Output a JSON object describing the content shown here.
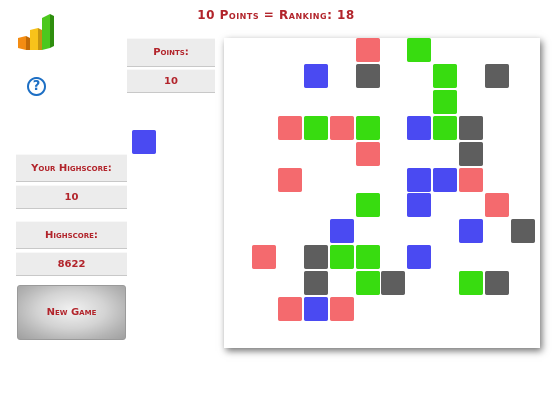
{
  "status_text": "10 Points = Ranking: 18",
  "points": {
    "label": "Points:",
    "value": "10"
  },
  "your_highscore": {
    "label": "Your Highscore:",
    "value": "10"
  },
  "highscore": {
    "label": "Highscore:",
    "value": "8622"
  },
  "new_game_label": "New Game",
  "help_symbol": "?",
  "icons": {
    "logo": "bar-chart-logo-icon",
    "help": "question-mark-icon"
  },
  "colors": {
    "red": "#f46a6e",
    "green": "#38dc10",
    "blue": "#4a4af2",
    "gray": "#5e5e5e",
    "accent_text": "#b2242b",
    "help_blue": "#1d6fc4"
  },
  "next_tile": "blue",
  "tiles": [
    {
      "row": 0,
      "col": 5,
      "color": "red"
    },
    {
      "row": 0,
      "col": 7,
      "color": "green"
    },
    {
      "row": 1,
      "col": 3,
      "color": "blue"
    },
    {
      "row": 1,
      "col": 5,
      "color": "gray"
    },
    {
      "row": 1,
      "col": 8,
      "color": "green"
    },
    {
      "row": 1,
      "col": 10,
      "color": "gray"
    },
    {
      "row": 2,
      "col": 8,
      "color": "green"
    },
    {
      "row": 3,
      "col": 2,
      "color": "red"
    },
    {
      "row": 3,
      "col": 3,
      "color": "green"
    },
    {
      "row": 3,
      "col": 4,
      "color": "red"
    },
    {
      "row": 3,
      "col": 5,
      "color": "green"
    },
    {
      "row": 3,
      "col": 7,
      "color": "blue"
    },
    {
      "row": 3,
      "col": 8,
      "color": "green"
    },
    {
      "row": 3,
      "col": 9,
      "color": "gray"
    },
    {
      "row": 4,
      "col": 5,
      "color": "red"
    },
    {
      "row": 4,
      "col": 9,
      "color": "gray"
    },
    {
      "row": 5,
      "col": 2,
      "color": "red"
    },
    {
      "row": 5,
      "col": 7,
      "color": "blue"
    },
    {
      "row": 5,
      "col": 8,
      "color": "blue"
    },
    {
      "row": 5,
      "col": 9,
      "color": "red"
    },
    {
      "row": 6,
      "col": 5,
      "color": "green"
    },
    {
      "row": 6,
      "col": 7,
      "color": "blue"
    },
    {
      "row": 6,
      "col": 10,
      "color": "red"
    },
    {
      "row": 7,
      "col": 4,
      "color": "blue"
    },
    {
      "row": 7,
      "col": 9,
      "color": "blue"
    },
    {
      "row": 7,
      "col": 11,
      "color": "gray"
    },
    {
      "row": 8,
      "col": 1,
      "color": "red"
    },
    {
      "row": 8,
      "col": 3,
      "color": "gray"
    },
    {
      "row": 8,
      "col": 4,
      "color": "green"
    },
    {
      "row": 8,
      "col": 5,
      "color": "green"
    },
    {
      "row": 8,
      "col": 7,
      "color": "blue"
    },
    {
      "row": 9,
      "col": 3,
      "color": "gray"
    },
    {
      "row": 9,
      "col": 5,
      "color": "green"
    },
    {
      "row": 9,
      "col": 6,
      "color": "gray"
    },
    {
      "row": 9,
      "col": 9,
      "color": "green"
    },
    {
      "row": 9,
      "col": 10,
      "color": "gray"
    },
    {
      "row": 10,
      "col": 2,
      "color": "red"
    },
    {
      "row": 10,
      "col": 3,
      "color": "blue"
    },
    {
      "row": 10,
      "col": 4,
      "color": "red"
    }
  ]
}
